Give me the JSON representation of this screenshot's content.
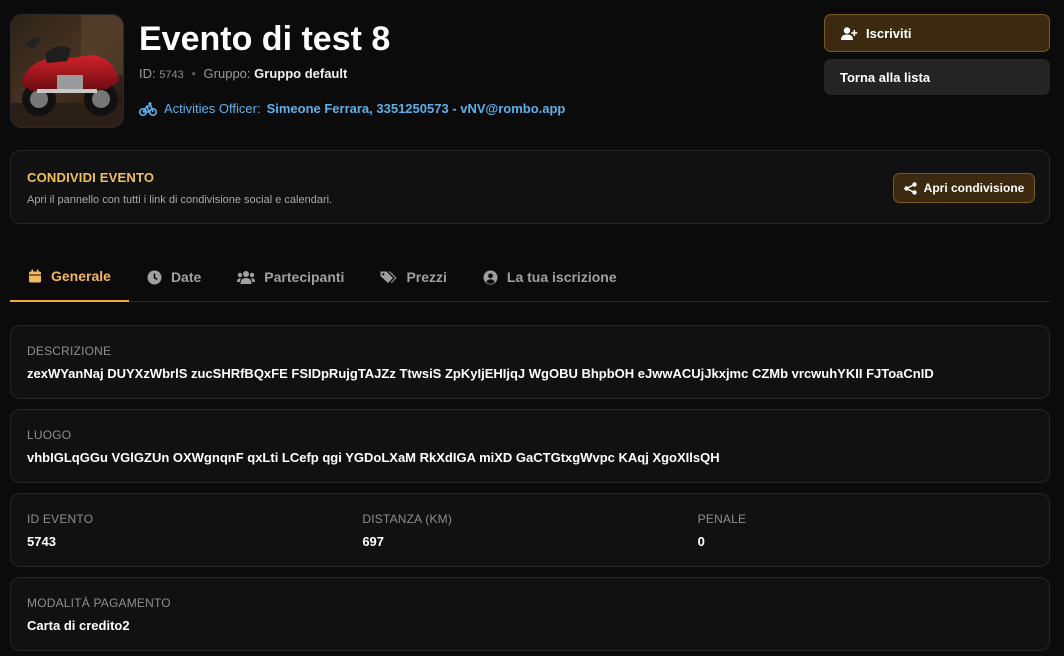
{
  "event": {
    "title": "Evento di test 8",
    "id_label": "ID:",
    "id_value": "5743",
    "group_label": "Gruppo:",
    "group_value": "Gruppo default",
    "officer_label": "Activities Officer:",
    "officer_contact": "Simeone Ferrara, 3351250573 - vNV@rombo.app"
  },
  "actions": {
    "subscribe_label": "Iscriviti",
    "back_label": "Torna alla lista"
  },
  "share": {
    "title": "CONDIVIDI EVENTO",
    "subtitle": "Apri il pannello con tutti i link di condivisione social e calendari.",
    "button_label": "Apri condivisione"
  },
  "tabs": [
    {
      "label": "Generale",
      "icon": "calendar-icon",
      "active": true
    },
    {
      "label": "Date",
      "icon": "clock-icon",
      "active": false
    },
    {
      "label": "Partecipanti",
      "icon": "users-icon",
      "active": false
    },
    {
      "label": "Prezzi",
      "icon": "tags-icon",
      "active": false
    },
    {
      "label": "La tua iscrizione",
      "icon": "user-circle-icon",
      "active": false
    }
  ],
  "details": {
    "description_label": "DESCRIZIONE",
    "description_value": "zexWYanNaj DUYXzWbrlS zucSHRfBQxFE FSIDpRujgTAJZz TtwsiS ZpKyIjEHIjqJ WgOBU BhpbOH eJwwACUjJkxjmc CZMb vrcwuhYKII FJToaCnID",
    "location_label": "LUOGO",
    "location_value": "vhbIGLqGGu VGlGZUn OXWgnqnF qxLti LCefp qgi YGDoLXaM RkXdIGA miXD GaCTGtxgWvpc KAqj XgoXIlsQH",
    "event_id_label": "ID EVENTO",
    "event_id_value": "5743",
    "distance_label": "DISTANZA (KM)",
    "distance_value": "697",
    "penalty_label": "PENALE",
    "penalty_value": "0",
    "payment_label": "MODALITÀ PAGAMENTO",
    "payment_value": "Carta di credito2"
  },
  "colors": {
    "accent": "#f2a94a",
    "link": "#5fb0ea",
    "share_title": "#f0c05a"
  }
}
